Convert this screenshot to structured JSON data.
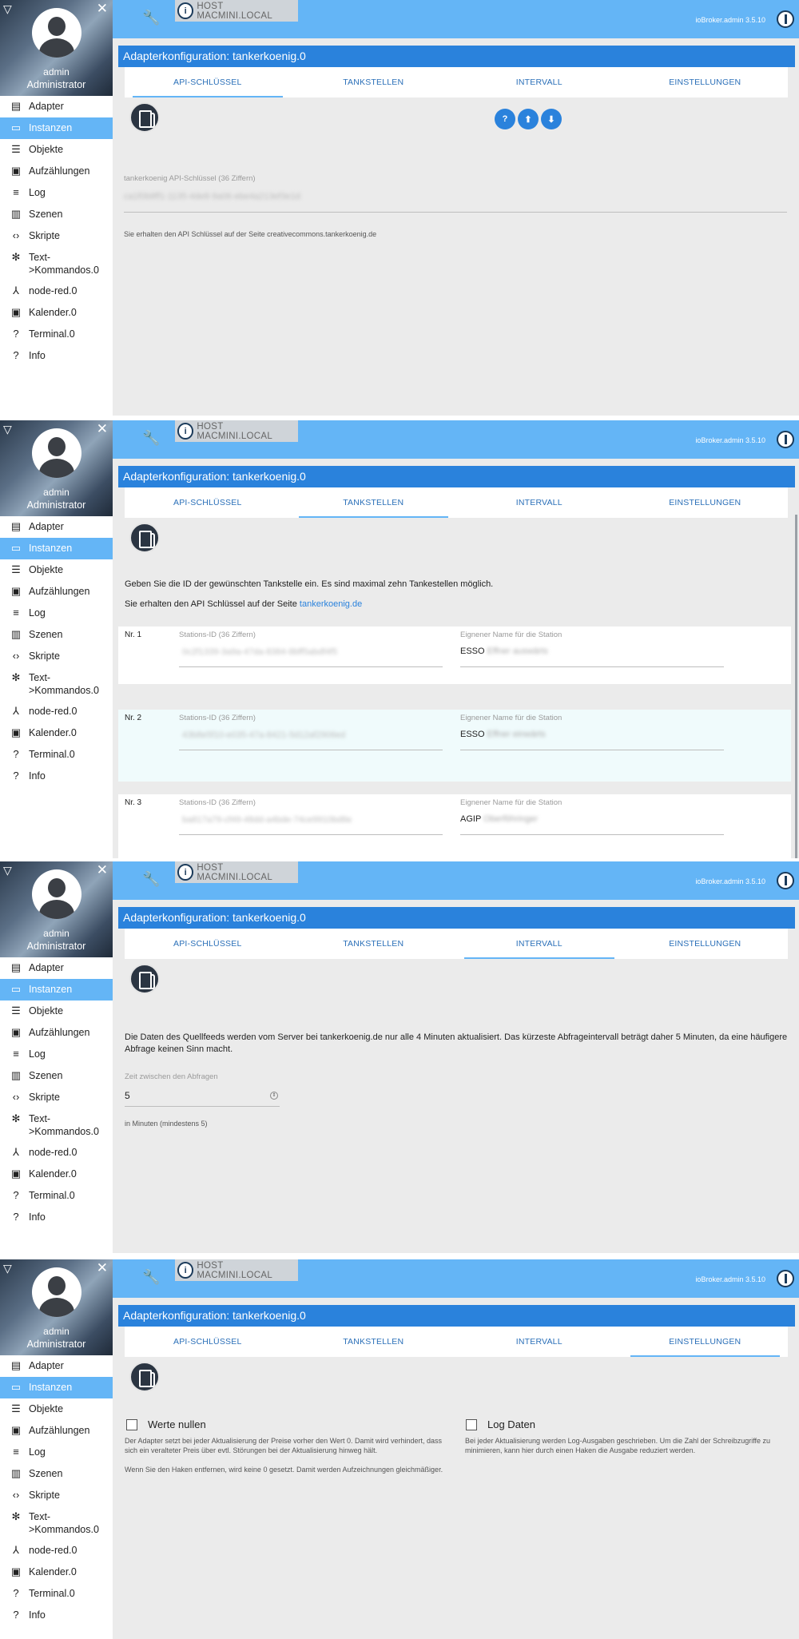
{
  "sidebar": {
    "user_name": "admin",
    "user_role": "Administrator",
    "items": [
      {
        "label": "Adapter",
        "icon": "adapter-icon"
      },
      {
        "label": "Instanzen",
        "icon": "instances-icon"
      },
      {
        "label": "Objekte",
        "icon": "objects-icon"
      },
      {
        "label": "Aufzählungen",
        "icon": "enums-icon"
      },
      {
        "label": "Log",
        "icon": "log-icon"
      },
      {
        "label": "Szenen",
        "icon": "scenes-icon"
      },
      {
        "label": "Skripte",
        "icon": "code-icon"
      },
      {
        "label": "Text->Kommandos.0",
        "icon": "snowflake-icon"
      },
      {
        "label": "node-red.0",
        "icon": "node-red-icon"
      },
      {
        "label": "Kalender.0",
        "icon": "calendar-icon"
      },
      {
        "label": "Terminal.0",
        "icon": "help-icon"
      },
      {
        "label": "Info",
        "icon": "info-icon"
      }
    ]
  },
  "topbar": {
    "host": "HOST MACMINI.LOCAL",
    "version": "ioBroker.admin 3.5.10"
  },
  "title": "Adapterkonfiguration: tankerkoenig.0",
  "tabs": [
    "API-SCHLÜSSEL",
    "TANKSTELLEN",
    "INTERVALL",
    "EINSTELLUNGEN"
  ],
  "api": {
    "help_icon": "?",
    "key_label": "tankerkoenig API-Schlüssel (36 Ziffern)",
    "key_value": "ca1f0b8ff1-1135-4de8-9a06-ebe4a213ef3e1d",
    "hint": "Sie erhalten den API Schlüssel auf der Seite creativecommons.tankerkoenig.de"
  },
  "stations": {
    "intro": "Geben Sie die ID der gewünschten Tankstelle ein. Es sind maximal zehn Tankestellen möglich.",
    "api_prefix": "Sie erhalten den API Schlüssel auf der Seite",
    "api_link": "tankerkoenig.de",
    "id_label": "Stations-ID (36 Ziffern)",
    "name_label": "Eignener Name für die Station",
    "rows": [
      {
        "nr": "Nr. 1",
        "id": "0c2f1339-3a9a-47da-8384-8bff5abdf4f5",
        "name": "ESSO",
        "name_rest": "Effner auswärts"
      },
      {
        "nr": "Nr. 2",
        "id": "43b8e5f10-e035-47a-8421-5d12af2906ed",
        "name": "ESSO",
        "name_rest": "Effner einwärts"
      },
      {
        "nr": "Nr. 3",
        "id": "ba817a79-cf49-48dd-a4bde-74ce9910bd8e",
        "name": "AGIP",
        "name_rest": "Oberföhringer"
      }
    ]
  },
  "interval": {
    "text": "Die Daten des Quellfeeds werden vom Server bei tankerkoenig.de nur alle 4 Minuten aktualisiert. Das kürzeste Abfrageintervall beträgt daher 5 Minuten, da eine häufigere Abfrage keinen Sinn macht.",
    "field_label": "Zeit zwischen den Abfragen",
    "value": "5",
    "helper": "in Minuten (mindestens 5)"
  },
  "settings": {
    "opt1_label": "Werte nullen",
    "opt1_desc": "Der Adapter setzt bei jeder Aktualisierung der Preise vorher den Wert 0. Damit wird verhindert, dass sich ein veralteter Preis über evtl. Störungen bei der Aktualisierung hinweg hält.",
    "opt1_desc2": "Wenn Sie den Haken entfernen, wird keine 0 gesetzt. Damit werden Aufzeichnungen gleichmäßiger.",
    "opt2_label": "Log Daten",
    "opt2_desc": "Bei jeder Aktualisierung werden Log-Ausgaben geschrieben. Um die Zahl der Schreibzugriffe zu minimieren, kann hier durch einen Haken die Ausgabe reduziert werden."
  }
}
